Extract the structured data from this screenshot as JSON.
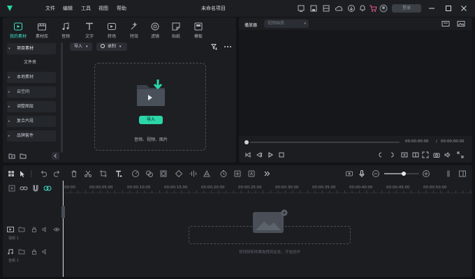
{
  "titlebar": {
    "menus": [
      "文件",
      "编辑",
      "工具",
      "视图",
      "帮助"
    ],
    "project_title": "未命名项目",
    "login_label": "登录"
  },
  "media_tabs": [
    {
      "label": "我的素材",
      "icon": "folder-icon",
      "active": true
    },
    {
      "label": "素材库",
      "icon": "library-icon",
      "active": false
    },
    {
      "label": "音频",
      "icon": "music-icon",
      "active": false
    },
    {
      "label": "文字",
      "icon": "text-icon",
      "active": false
    },
    {
      "label": "转场",
      "icon": "transition-icon",
      "active": false
    },
    {
      "label": "特效",
      "icon": "effects-icon",
      "active": false
    },
    {
      "label": "滤镜",
      "icon": "filter-icon",
      "active": false
    },
    {
      "label": "贴纸",
      "icon": "sticker-icon",
      "active": false
    },
    {
      "label": "模板",
      "icon": "template-icon",
      "active": false
    }
  ],
  "sidebar": {
    "items": [
      {
        "label": "项目素材",
        "arrow": "▾"
      },
      {
        "label": "文件夹",
        "arrow": ""
      },
      {
        "label": "本地素材",
        "arrow": "▸"
      },
      {
        "label": "云空间",
        "arrow": "▸"
      },
      {
        "label": "调整图层",
        "arrow": "▸"
      },
      {
        "label": "复合片段",
        "arrow": "▸"
      },
      {
        "label": "品牌套件",
        "arrow": "▸"
      }
    ]
  },
  "media_toolbar": {
    "import_label": "导入",
    "record_label": "录制"
  },
  "dropzone": {
    "import_button": "导入",
    "hint": "音频、视频、图片"
  },
  "player": {
    "label": "播放器",
    "quality_placeholder": "视频画质",
    "current_time": "00:00:00:00",
    "separator": "/",
    "total_time": "00:00:00:00"
  },
  "timeline": {
    "ruler": [
      "00:00",
      "00:00:05:00",
      "00:00:10:00",
      "00:00:15:00",
      "00:00:20:00",
      "00:00:25:00",
      "00:00:30:00",
      "00:00:35:00",
      "00:00:40:00",
      "00:00:45:00",
      "00:00:50:00"
    ],
    "video_track_label": "视频 1",
    "audio_track_label": "音频 1",
    "empty_hint": "将视频和效果拖拽到此处，开始创作"
  },
  "colors": {
    "accent": "#3fe0c4",
    "accent_button": "#2bd6a8",
    "record_dot": "#e6e6e6"
  }
}
